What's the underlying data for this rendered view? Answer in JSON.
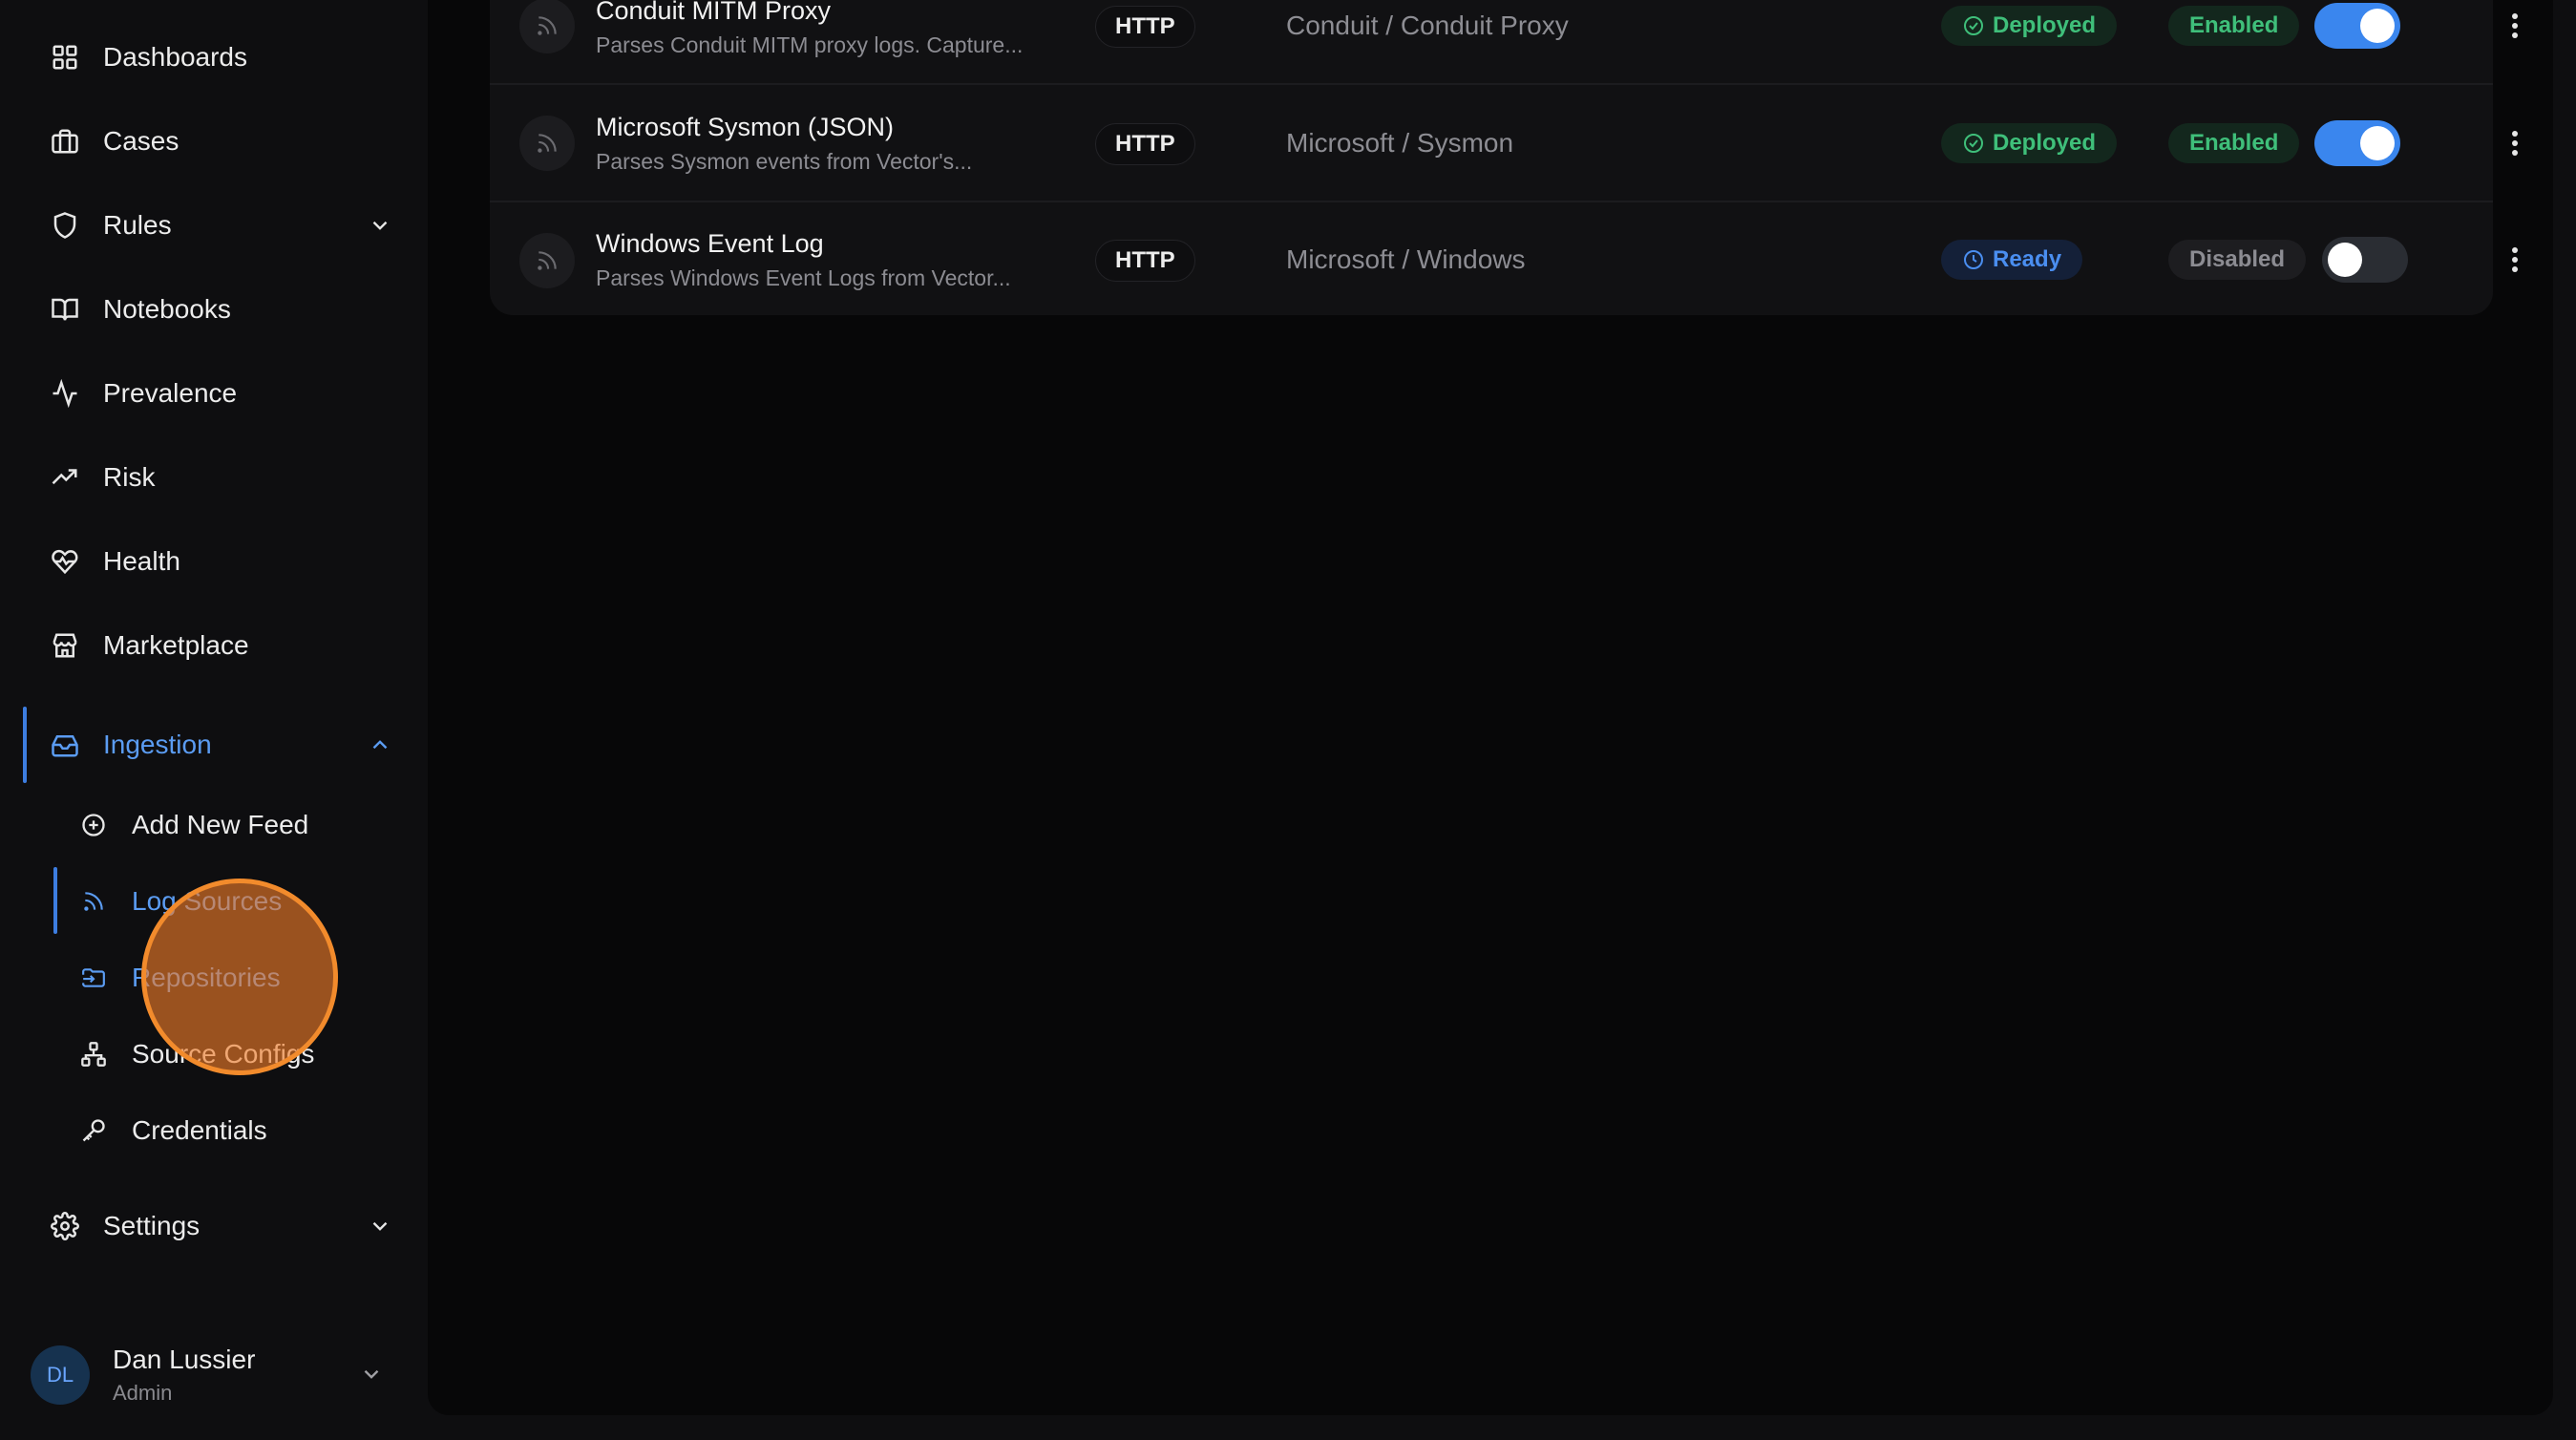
{
  "sidebar": {
    "nav": {
      "dashboards": "Dashboards",
      "cases": "Cases",
      "rules": "Rules",
      "notebooks": "Notebooks",
      "prevalence": "Prevalence",
      "risk": "Risk",
      "health": "Health",
      "marketplace": "Marketplace",
      "ingestion": "Ingestion",
      "settings": "Settings"
    },
    "ingestion_sub": {
      "add_new_feed": "Add New Feed",
      "log_sources": "Log Sources",
      "repositories": "Repositories",
      "source_configs": "Source Configs",
      "credentials": "Credentials"
    },
    "user": {
      "initials": "DL",
      "name": "Dan Lussier",
      "role": "Admin"
    }
  },
  "feeds": [
    {
      "name": "Conduit MITM Proxy",
      "description": "Parses Conduit MITM proxy logs. Capture...",
      "protocol": "HTTP",
      "vendor": "Conduit / Conduit Proxy",
      "status": "Deployed",
      "enabled_label": "Enabled",
      "enabled": true
    },
    {
      "name": "Microsoft Sysmon (JSON)",
      "description": "Parses Sysmon events from Vector's...",
      "protocol": "HTTP",
      "vendor": "Microsoft / Sysmon",
      "status": "Deployed",
      "enabled_label": "Enabled",
      "enabled": true
    },
    {
      "name": "Windows Event Log",
      "description": "Parses Windows Event Logs from Vector...",
      "protocol": "HTTP",
      "vendor": "Microsoft / Windows",
      "status": "Ready",
      "enabled_label": "Disabled",
      "enabled": false
    }
  ],
  "colors": {
    "accent": "#3a86ee",
    "deployed": "#3fbf7a",
    "ready": "#4a8ef0",
    "click_indicator": "#f28b2c"
  }
}
